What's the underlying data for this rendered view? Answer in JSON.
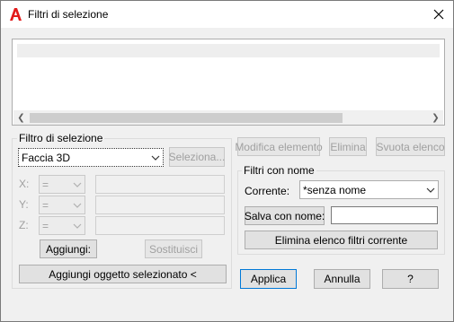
{
  "window": {
    "title": "Filtri di selezione"
  },
  "selection_filter": {
    "group_label": "Filtro di selezione",
    "object_type": "Faccia 3D",
    "select_button": "Seleziona...",
    "x_label": "X:",
    "y_label": "Y:",
    "z_label": "Z:",
    "x_operator": "=",
    "y_operator": "=",
    "z_operator": "=",
    "add_button": "Aggiungi:",
    "replace_button": "Sostituisci",
    "add_selected_button": "Aggiungi oggetto selezionato <"
  },
  "list_actions": {
    "edit_item": "Modifica elemento",
    "delete": "Elimina",
    "clear_list": "Svuota elenco"
  },
  "named_filters": {
    "group_label": "Filtri con nome",
    "current_label": "Corrente:",
    "current_value": "*senza nome",
    "save_as_button": "Salva con nome:",
    "save_as_value": "",
    "delete_current_button": "Elimina elenco filtri corrente"
  },
  "footer": {
    "apply": "Applica",
    "cancel": "Annulla",
    "help": "?"
  },
  "colors": {
    "accent": "#0078d7",
    "app_icon": "#e21b1b"
  }
}
